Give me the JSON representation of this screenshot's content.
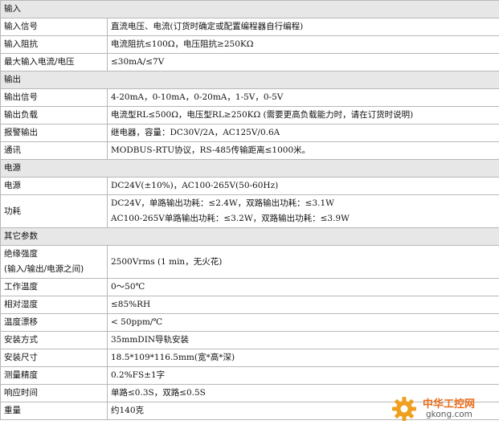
{
  "sections": [
    {
      "title": "输入",
      "rows": [
        {
          "label": "输入信号",
          "value": "直流电压、电流(订货时确定或配置编程器自行编程)"
        },
        {
          "label": "输入阻抗",
          "value": "电流阻抗≤100Ω，电压阻抗≥250KΩ"
        },
        {
          "label": "最大输入电流/电压",
          "value": "≤30mA/≤7V"
        }
      ]
    },
    {
      "title": "输出",
      "rows": [
        {
          "label": "输出信号",
          "value": "4-20mA，0-10mA，0-20mA，1-5V，0-5V"
        },
        {
          "label": "输出负载",
          "value": "电流型RL≤500Ω，电压型RL≥250KΩ (需要更高负载能力时，请在订货时说明)"
        },
        {
          "label": "报警输出",
          "value": "继电器，容量：DC30V/2A，AC125V/0.6A"
        },
        {
          "label": "通讯",
          "value": "MODBUS-RTU协议，RS-485传输距离≤1000米。"
        }
      ]
    },
    {
      "title": "电源",
      "rows": [
        {
          "label": "电源",
          "value": "DC24V(±10%)，AC100-265V(50-60Hz)"
        },
        {
          "label": "功耗",
          "value": "DC24V，单路输出功耗：≤2.4W，双路输出功耗：≤3.1W",
          "value2": "AC100-265V单路输出功耗：≤3.2W，双路输出功耗：≤3.9W"
        }
      ]
    },
    {
      "title": "其它参数",
      "rows": [
        {
          "label": "绝缘强度",
          "label2": "(输入/输出/电源之间)",
          "value": "2500Vrms (1 min，无火花)"
        },
        {
          "label": "工作温度",
          "value": "0～50℃"
        },
        {
          "label": "相对湿度",
          "value": "≤85%RH"
        },
        {
          "label": "温度漂移",
          "value": "< 50ppm/℃"
        },
        {
          "label": "安装方式",
          "value": "35mmDIN导轨安装"
        },
        {
          "label": "安装尺寸",
          "value": "18.5*109*116.5mm(宽*高*深)"
        },
        {
          "label": "测量精度",
          "value": "0.2%FS±1字"
        },
        {
          "label": "响应时间",
          "value": "单路≤0.3S，双路≤0.5S"
        },
        {
          "label": "重量",
          "value": "约140克"
        }
      ]
    }
  ],
  "watermark": {
    "title": "中华工控网",
    "domain": "gkong.com",
    "gear_icon": "gear-icon",
    "colors": {
      "orange": "#f0a020",
      "accent": "#e86c1a"
    }
  }
}
